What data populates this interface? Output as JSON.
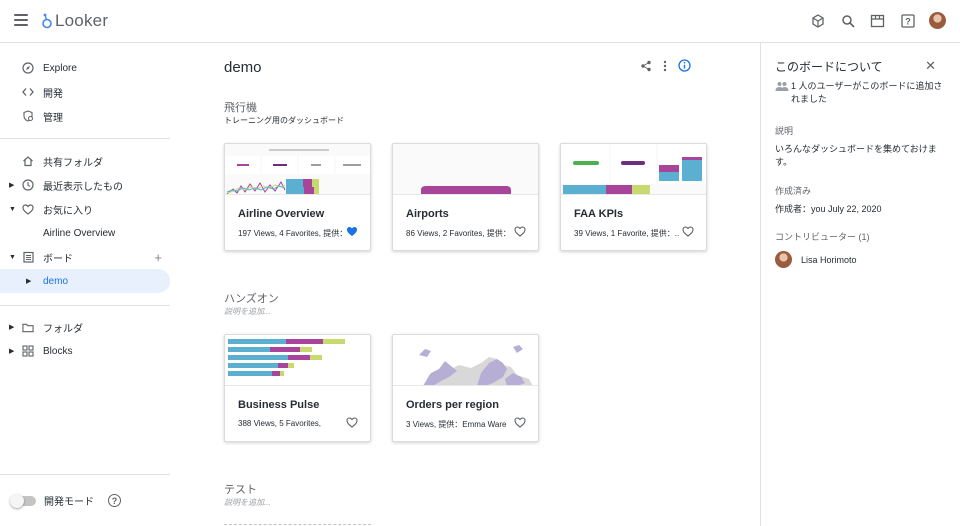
{
  "app": {
    "name": "Looker"
  },
  "sidebar": {
    "items": [
      {
        "label": "Explore"
      },
      {
        "label": "開発"
      },
      {
        "label": "管理"
      },
      {
        "label": "共有フォルダ"
      },
      {
        "label": "最近表示したもの"
      },
      {
        "label": "お気に入り"
      },
      {
        "label": "Airline Overview"
      },
      {
        "label": "ボード"
      },
      {
        "label": "demo"
      },
      {
        "label": "フォルダ"
      },
      {
        "label": "Blocks"
      }
    ],
    "dev_mode_label": "開発モード",
    "help": "?"
  },
  "main": {
    "title": "demo",
    "sections": [
      {
        "title": "飛行機",
        "subtitle": "トレーニング用のダッシュボード",
        "cards": [
          {
            "name": "Airline Overview",
            "meta": "197 Views, 4 Favorites, 提供：...",
            "favorited": true
          },
          {
            "name": "Airports",
            "meta": "86 Views, 2 Favorites, 提供：...",
            "favorited": false
          },
          {
            "name": "FAA KPIs",
            "meta": "39 Views, 1 Favorite, 提供：...",
            "favorited": false
          }
        ]
      },
      {
        "title": "ハンズオン",
        "subtitle": "説明を追加...",
        "cards": [
          {
            "name": "Business Pulse",
            "meta": "388 Views, 5 Favorites,",
            "favorited": false
          },
          {
            "name": "Orders per region",
            "meta": "3 Views, 提供：Emma Ware",
            "favorited": false
          }
        ]
      },
      {
        "title": "テスト",
        "subtitle": "説明を追加..."
      }
    ]
  },
  "panel": {
    "title": "このボードについて",
    "users_text": "1 人のユーザーがこのボードに追加されました",
    "description_label": "説明",
    "description": "いろんなダッシュボードを集めておけます。",
    "created_label": "作成済み",
    "created_value": "作成者：you July 22, 2020",
    "contributors_label": "コントリビューター (1)",
    "contributors": [
      {
        "name": "Lisa Horimoto"
      }
    ]
  },
  "colors": {
    "accent": "#1a73e8",
    "purple": "#a8449a",
    "blue": "#5bb0d1",
    "green": "#c8d96f",
    "dark_purple": "#6b2f7f",
    "lavender": "#b7aed6"
  }
}
